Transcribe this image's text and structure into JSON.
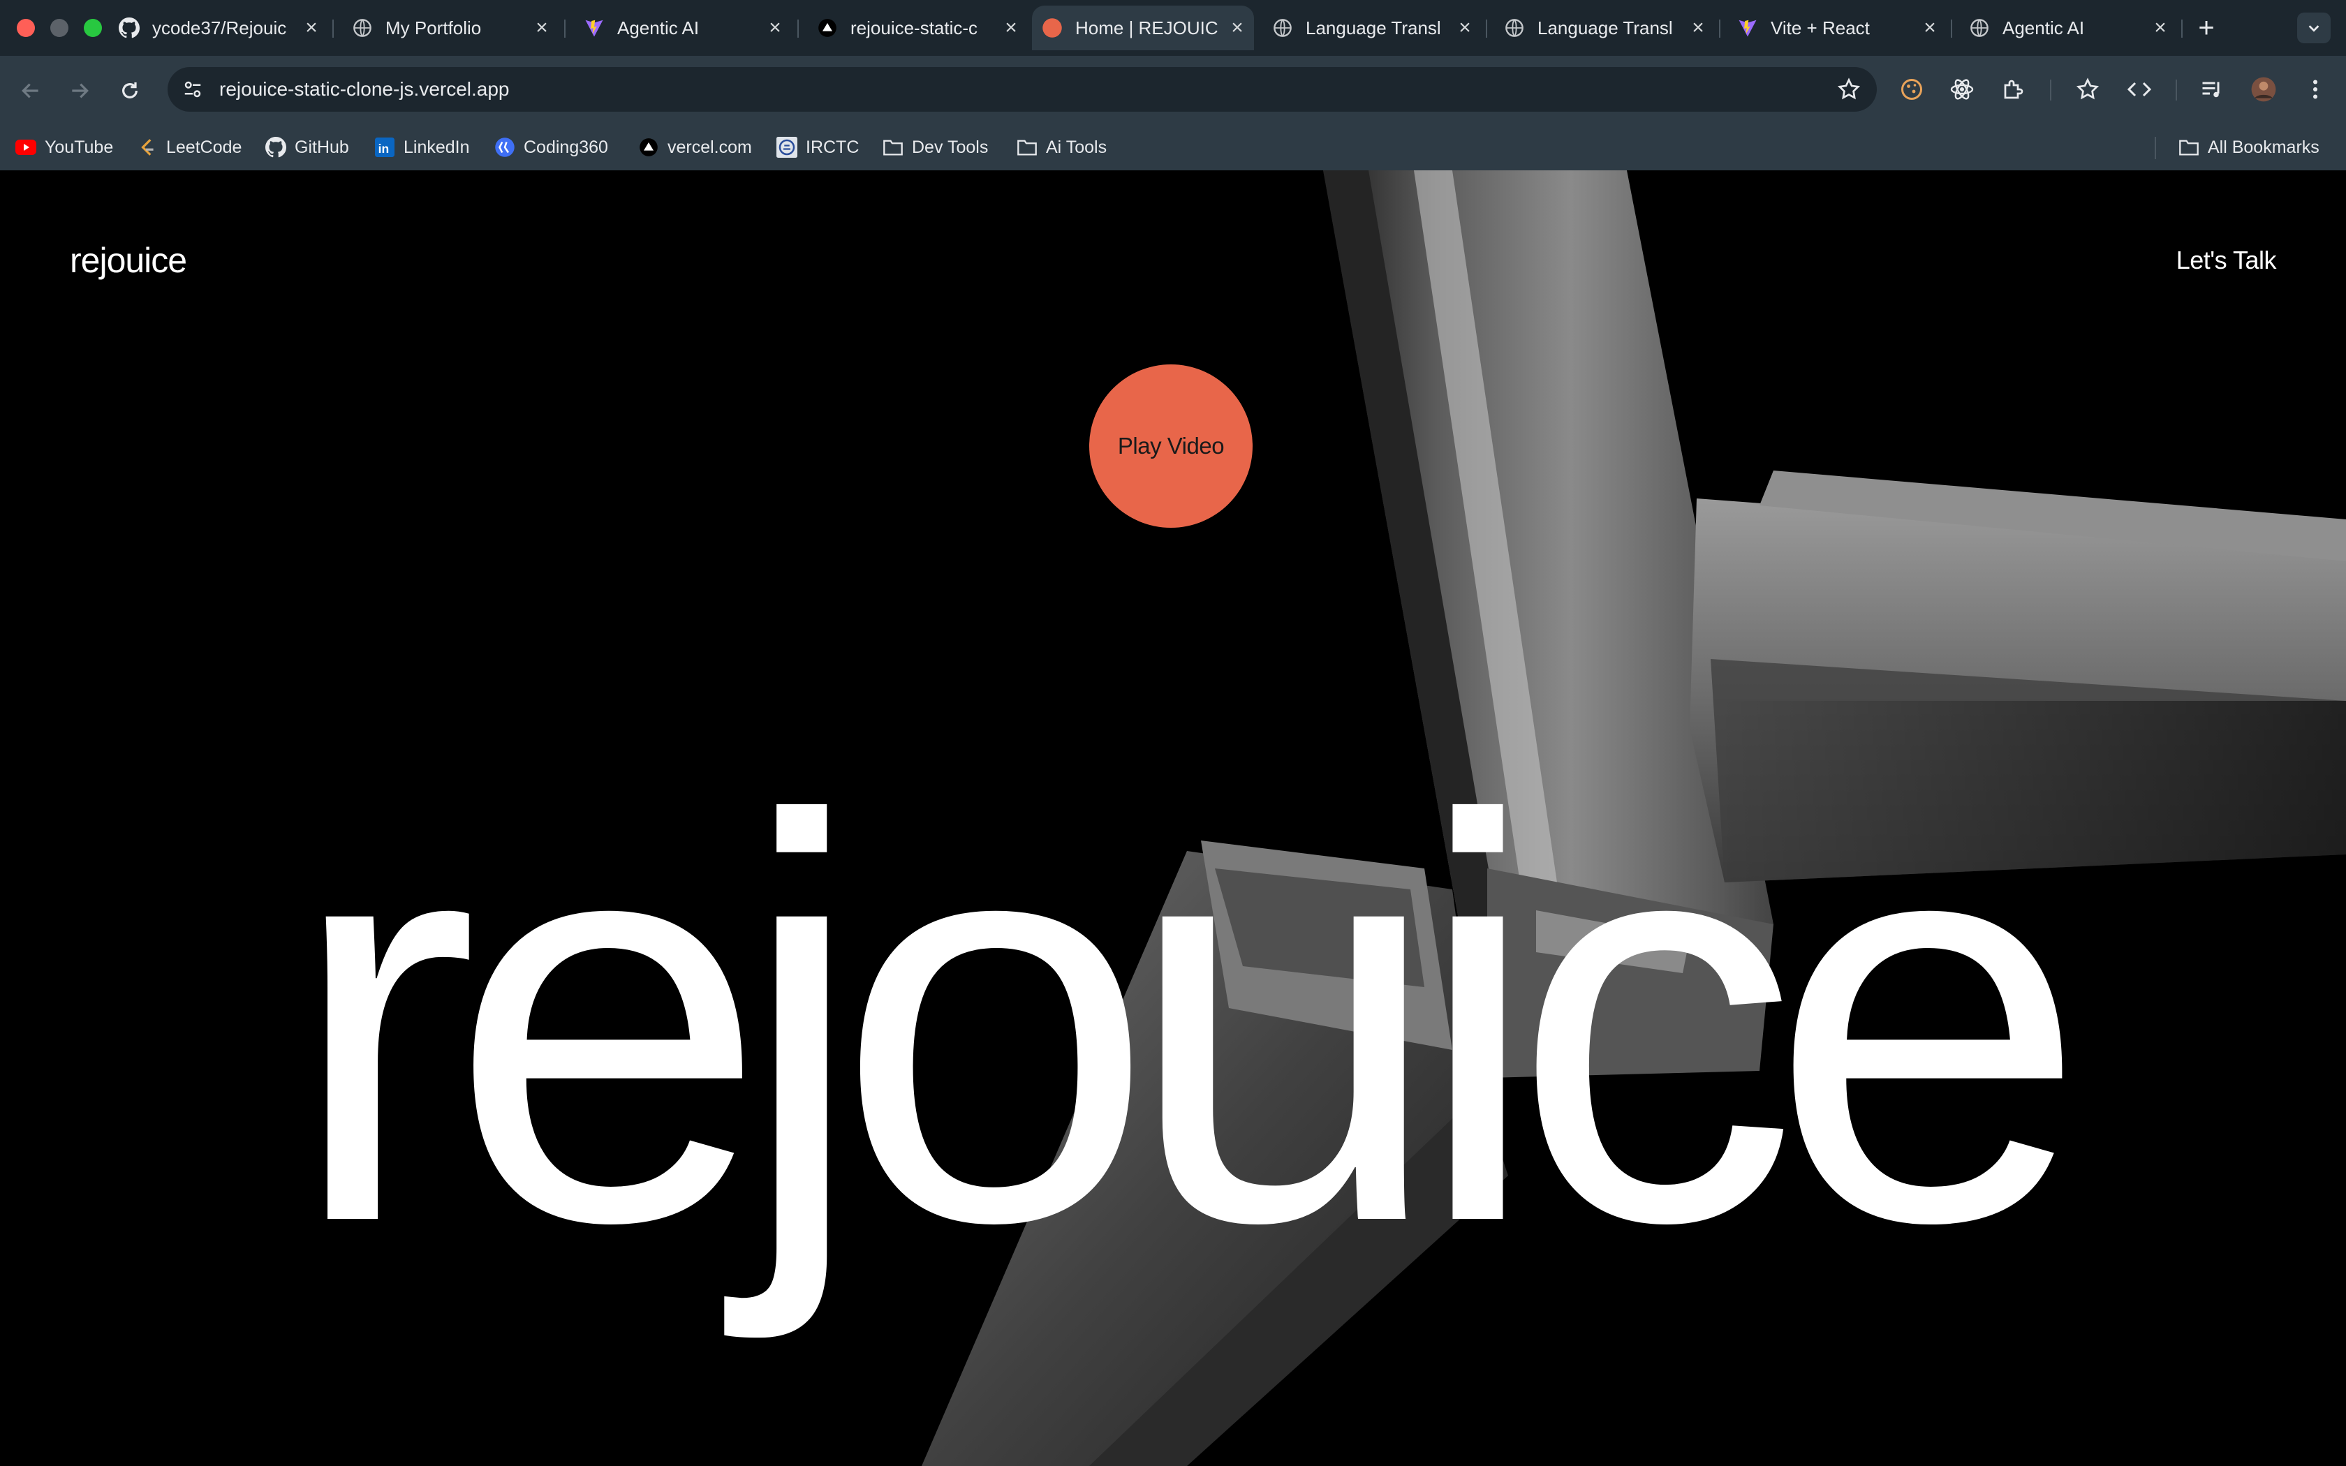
{
  "browser": {
    "tabs": [
      {
        "title": "ycode37/Rejouic",
        "icon": "github-icon"
      },
      {
        "title": "My Portfolio",
        "icon": "globe-icon"
      },
      {
        "title": "Agentic AI",
        "icon": "vite-icon"
      },
      {
        "title": "rejouice-static-c",
        "icon": "vercel-icon"
      },
      {
        "title": "Home | REJOUIC",
        "icon": "orange-dot-icon",
        "active": true
      },
      {
        "title": "Language Transl",
        "icon": "globe-icon"
      },
      {
        "title": "Language Transl",
        "icon": "globe-icon"
      },
      {
        "title": "Vite + React",
        "icon": "vite-icon"
      },
      {
        "title": "Agentic AI",
        "icon": "globe-icon"
      }
    ],
    "url": "rejouice-static-clone-js.vercel.app",
    "bookmarks": [
      {
        "label": "YouTube",
        "icon": "youtube-icon"
      },
      {
        "label": "LeetCode",
        "icon": "leetcode-icon"
      },
      {
        "label": "GitHub",
        "icon": "github-icon"
      },
      {
        "label": "LinkedIn",
        "icon": "linkedin-icon"
      },
      {
        "label": "Coding360",
        "icon": "coding360-icon"
      },
      {
        "label": "vercel.com",
        "icon": "vercel-icon"
      },
      {
        "label": "IRCTC",
        "icon": "irctc-icon"
      },
      {
        "label": "Dev Tools",
        "icon": "folder-icon"
      },
      {
        "label": "Ai Tools",
        "icon": "folder-icon"
      }
    ],
    "all_bookmarks": "All Bookmarks"
  },
  "site": {
    "logo": "rejouice",
    "cta": "Let's Talk",
    "play_button": "Play Video",
    "hero_word": "rejouice",
    "accent_color": "#e8664a"
  }
}
